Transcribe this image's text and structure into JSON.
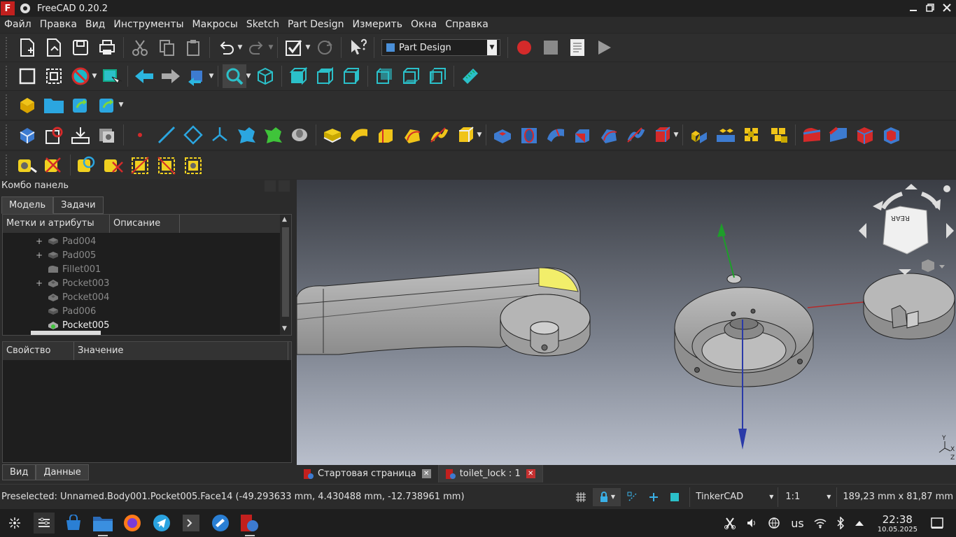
{
  "window": {
    "title": "FreeCAD 0.20.2",
    "app_icon": "F",
    "min_icon": "minimize-icon",
    "max_icon": "maximize-icon",
    "close_icon": "close-icon"
  },
  "menu": [
    "Файл",
    "Правка",
    "Вид",
    "Инструменты",
    "Макросы",
    "Sketch",
    "Part Design",
    "Измерить",
    "Окна",
    "Справка"
  ],
  "toolbar": {
    "workbench": "Part Design"
  },
  "combo": {
    "title": "Комбо панель",
    "tabs": [
      "Модель",
      "Задачи"
    ]
  },
  "tree": {
    "headers": [
      "Метки и атрибуты",
      "Описание"
    ],
    "rows": [
      {
        "expander": "+",
        "label": "Pad004"
      },
      {
        "expander": "+",
        "label": "Pad005"
      },
      {
        "expander": "",
        "label": "Fillet001"
      },
      {
        "expander": "+",
        "label": "Pocket003"
      },
      {
        "expander": "",
        "label": "Pocket004"
      },
      {
        "expander": "",
        "label": "Pad006"
      },
      {
        "expander": "",
        "label": "Pocket005"
      }
    ]
  },
  "props": {
    "headers": [
      "Свойство",
      "Значение"
    ]
  },
  "bottom_tabs": [
    "Вид",
    "Данные"
  ],
  "doc_tabs": [
    {
      "label": "Стартовая страница"
    },
    {
      "label": "toilet_lock : 1"
    }
  ],
  "status": {
    "message": "Preselected: Unnamed.Body001.Pocket005.Face14 (-49.293633 mm, 4.430488 mm, -12.738961 mm)",
    "nav_style": "TinkerCAD",
    "scale": "1:1",
    "dims": "189,23 mm x 81,87 mm"
  },
  "navcube": {
    "face": "REAR"
  },
  "axis_labels": {
    "y": "Y",
    "z": "Z",
    "x": "X"
  },
  "taskbar": {
    "lang": "us",
    "time": "22:38",
    "date": "10.05.2025"
  }
}
